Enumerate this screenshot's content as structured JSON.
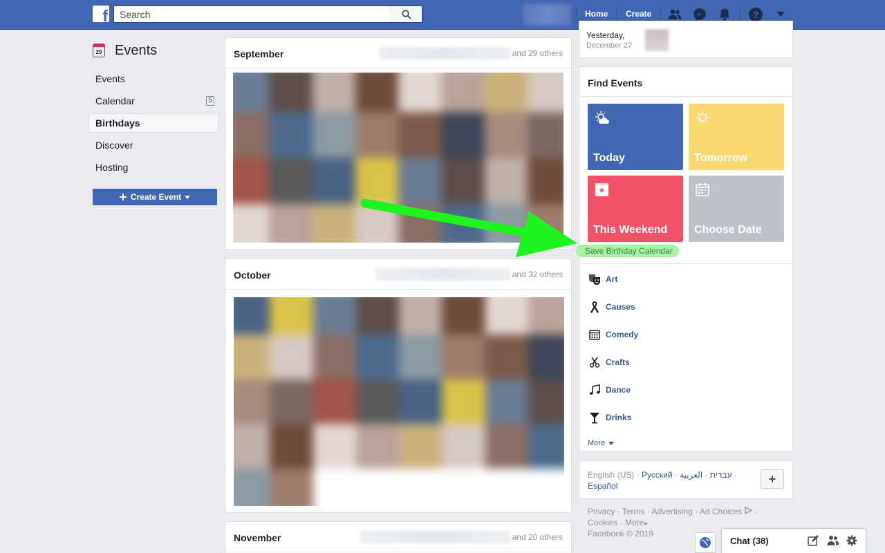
{
  "topbar": {
    "search_placeholder": "Search",
    "nav": {
      "home": "Home",
      "create": "Create"
    }
  },
  "left_nav": {
    "title": "Events",
    "calendar_icon_day": "29",
    "items": [
      {
        "label": "Events"
      },
      {
        "label": "Calendar",
        "badge": "5"
      },
      {
        "label": "Birthdays",
        "active": true
      },
      {
        "label": "Discover"
      },
      {
        "label": "Hosting"
      }
    ],
    "create_button": "Create Event"
  },
  "months": [
    {
      "name": "September",
      "others": "and 29 others"
    },
    {
      "name": "October",
      "others": "and 32 others"
    },
    {
      "name": "November",
      "others": "and 20 others"
    }
  ],
  "right": {
    "yesterday": {
      "line1": "Yesterday,",
      "line2": "December 27"
    },
    "find_events": {
      "title": "Find Events",
      "tiles": [
        {
          "label": "Today",
          "color": "#4267b2",
          "icon": "sun-cloud-icon"
        },
        {
          "label": "Tomorrow",
          "color": "#f9d771",
          "icon": "sun-icon"
        },
        {
          "label": "This Weekend",
          "color": "#f25268",
          "icon": "star-calendar-icon"
        },
        {
          "label": "Choose Date",
          "color": "#bec3c9",
          "icon": "calendar-icon"
        }
      ],
      "save_calendar": "Save Birthday Calendar",
      "categories": [
        {
          "label": "Art",
          "icon": "masks-icon"
        },
        {
          "label": "Causes",
          "icon": "ribbon-icon"
        },
        {
          "label": "Comedy",
          "icon": "calendar-grid-icon"
        },
        {
          "label": "Crafts",
          "icon": "scissors-icon"
        },
        {
          "label": "Dance",
          "icon": "music-note-icon"
        },
        {
          "label": "Drinks",
          "icon": "cocktail-icon"
        }
      ],
      "more": "More"
    },
    "languages": {
      "current": "English (US)",
      "others": [
        "Русский",
        "עברית",
        "العربية",
        "Español"
      ]
    },
    "footer": {
      "links": [
        "Privacy",
        "Terms",
        "Advertising",
        "Ad Choices",
        "Cookies",
        "More"
      ],
      "copyright": "Facebook © 2019"
    }
  },
  "chat": {
    "label": "Chat (38)"
  }
}
